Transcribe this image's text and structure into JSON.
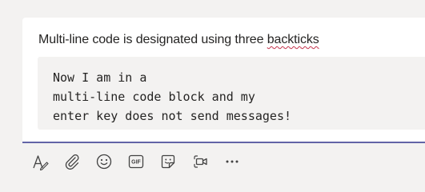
{
  "compose": {
    "text_before": "Multi-line code is designated using three ",
    "misspelled_word": "backticks",
    "code_lines": [
      "Now I am in a",
      "multi-line code block and my",
      "enter key does not send messages!"
    ]
  },
  "toolbar": {
    "items": [
      {
        "name": "format",
        "icon": "format-icon"
      },
      {
        "name": "attach",
        "icon": "paperclip-icon"
      },
      {
        "name": "emoji",
        "icon": "emoji-icon"
      },
      {
        "name": "gif",
        "icon": "gif-icon",
        "label": "GIF"
      },
      {
        "name": "sticker",
        "icon": "sticker-icon"
      },
      {
        "name": "meet-now",
        "icon": "video-meet-icon"
      },
      {
        "name": "more-options",
        "icon": "ellipsis-icon"
      }
    ]
  },
  "colors": {
    "accent": "#6264a7",
    "spell_underline": "#c4314b",
    "code_background": "#f3f2f1",
    "page_background": "#f3f2f1"
  }
}
